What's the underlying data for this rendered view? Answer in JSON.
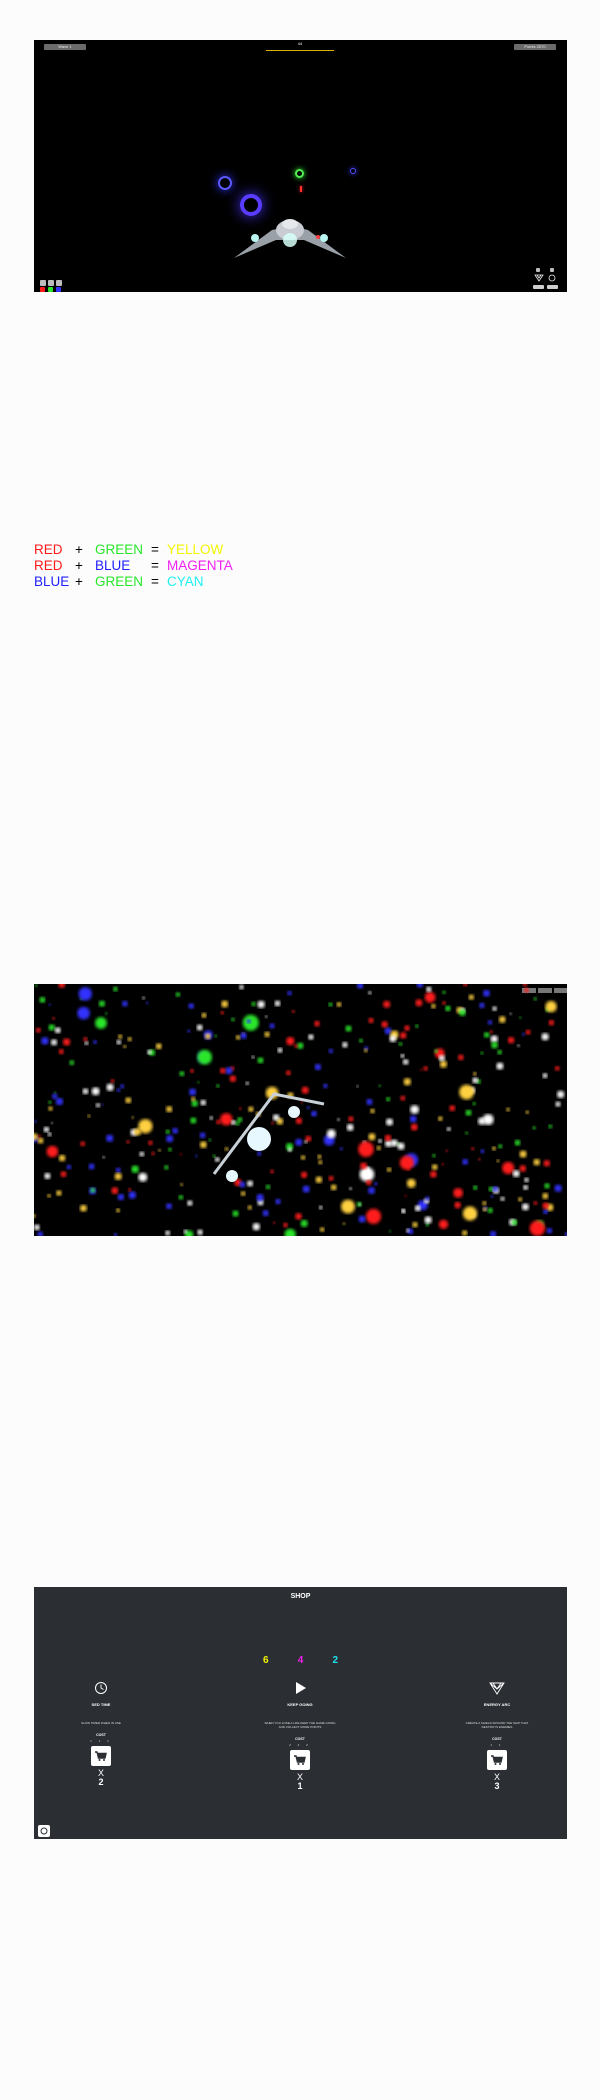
{
  "game": {
    "left_pill": "Wave 1",
    "top_center": "44",
    "right_pill": "Points 2570",
    "colors": {
      "red": "#ff1a1a",
      "green": "#29e62a",
      "blue": "#3030ff",
      "yellow": "#f5f500",
      "magenta": "#f020f0",
      "cyan": "#20f0f0"
    }
  },
  "rules": [
    {
      "a": "RED",
      "op": "+",
      "b": "GREEN",
      "eq": "=",
      "r": "YELLOW",
      "ac": "#ff1a1a",
      "bc": "#29e62a",
      "rc": "#f5f500"
    },
    {
      "a": "RED",
      "op": "+",
      "b": "BLUE",
      "eq": "=",
      "r": "MAGENTA",
      "ac": "#ff1a1a",
      "bc": "#2020ff",
      "rc": "#f020f0"
    },
    {
      "a": "BLUE",
      "op": "+",
      "b": "GREEN",
      "eq": "=",
      "r": "CYAN",
      "ac": "#2020ff",
      "bc": "#29e62a",
      "rc": "#20f0f0"
    }
  ],
  "shop": {
    "title": "SHOP",
    "counts": [
      {
        "value": "6",
        "color": "#f5f500"
      },
      {
        "value": "4",
        "color": "#f020f0"
      },
      {
        "value": "2",
        "color": "#20e0f0"
      }
    ],
    "items": [
      {
        "icon": "clock-icon",
        "title": "SED TIME",
        "desc": "SLOW TIMER WHEN IN USE",
        "cost": "COST",
        "x": "X",
        "qty": "2"
      },
      {
        "icon": "play-icon",
        "title": "KEEP GOING",
        "desc": "WHEN YOU LOSE A LIFE KEEP THE GAME GOING AND COLLECT MORE POINTS",
        "cost": "COST",
        "x": "X",
        "qty": "1"
      },
      {
        "icon": "shield-icon",
        "title": "ENERGY ARC",
        "desc": "CREATE A SHIELD AROUND THE SHIP THAT DESTROYS ENEMIES",
        "cost": "COST",
        "x": "X",
        "qty": "3"
      }
    ]
  }
}
